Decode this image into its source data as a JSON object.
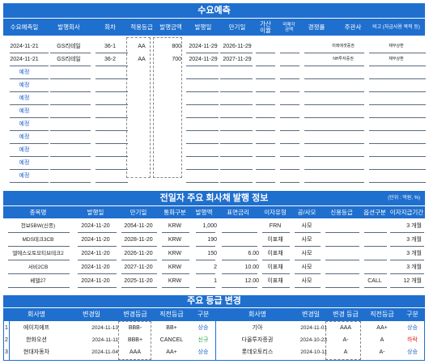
{
  "forecast": {
    "title": "수요예측",
    "headers": {
      "date": "수요예측일",
      "issuer": "발행회사",
      "round": "회차",
      "grade": "적용등급",
      "amount": "발행금액",
      "issue_date": "발행일",
      "maturity": "만기일",
      "extra_line1": "가산",
      "extra_line2": "이율",
      "unsold_line1": "미매각",
      "unsold_line2": "금액",
      "competition": "경쟁률",
      "manager": "주관사",
      "note": "비고 (자금사용 목적 등)"
    },
    "rows": [
      {
        "date": "2024-11-21",
        "issuer": "GS리테일",
        "round": "36-1",
        "grade": "AA",
        "amount": "800",
        "issue_date": "2024-11-29",
        "maturity": "2026-11-29",
        "manager": "미래에셋증권",
        "note": "채무상환"
      },
      {
        "date": "2024-11-21",
        "issuer": "GS리테일",
        "round": "36-2",
        "grade": "AA",
        "amount": "700",
        "issue_date": "2024-11-29",
        "maturity": "2027-11-29",
        "manager": "NH투자증권",
        "note": "채무상환"
      }
    ],
    "placeholder": "예정"
  },
  "issuance": {
    "title": "전일자 주요 회사채 발행 정보",
    "unit": "(단위 : 억원, %)",
    "headers": {
      "name": "종목명",
      "issue_date": "발행일",
      "maturity": "만기일",
      "currency": "통화구분",
      "amount": "발행액",
      "coupon": "표면금리",
      "rate_type": "이자유형",
      "offer": "공/사모",
      "credit": "신용등급",
      "option": "옵션구분",
      "period": "이자지급기간"
    },
    "rows": [
      {
        "name": "천보5BW(신종)",
        "issue_date": "2024-11-20",
        "maturity": "2054-11-20",
        "currency": "KRW",
        "amount": "1,000",
        "coupon": "",
        "rate_type": "FRN",
        "offer": "사모",
        "credit": "",
        "option": "",
        "period": "3 개월"
      },
      {
        "name": "MDS테크3CB",
        "issue_date": "2024-11-20",
        "maturity": "2028-11-20",
        "currency": "KRW",
        "amount": "190",
        "coupon": "",
        "rate_type": "이표채",
        "offer": "사모",
        "credit": "",
        "option": "",
        "period": "3 개월"
      },
      {
        "name": "엘에스오토모티브테크2",
        "issue_date": "2024-11-20",
        "maturity": "2026-11-20",
        "currency": "KRW",
        "amount": "150",
        "coupon": "6.00",
        "rate_type": "이표채",
        "offer": "사모",
        "credit": "",
        "option": "",
        "period": "3 개월"
      },
      {
        "name": "서비2CB",
        "issue_date": "2024-11-20",
        "maturity": "2027-11-20",
        "currency": "KRW",
        "amount": "2",
        "coupon": "10.00",
        "rate_type": "이표채",
        "offer": "사모",
        "credit": "",
        "option": "",
        "period": "3 개월"
      },
      {
        "name": "베델27",
        "issue_date": "2024-11-20",
        "maturity": "2025-11-20",
        "currency": "KRW",
        "amount": "1",
        "coupon": "12.00",
        "rate_type": "이표채",
        "offer": "사모",
        "credit": "",
        "option": "CALL",
        "period": "12 개월"
      }
    ]
  },
  "grades": {
    "title": "주요 등급 변경",
    "headers": {
      "company": "회사명",
      "date": "변경일",
      "new_grade": "변경등급",
      "old_grade": "직전등급",
      "type": "구분",
      "company2": "회사명",
      "date2": "변경일",
      "new_grade2": "변경 등급",
      "old_grade2": "직전등급",
      "type2": "구분"
    },
    "rows": [
      {
        "no": "1",
        "company": "에이치에프",
        "date": "2024-11-13",
        "new_grade": "BBB-",
        "old_grade": "BB+",
        "type": "상승",
        "company2": "기아",
        "date2": "2024-11-01",
        "new_grade2": "AAA",
        "old_grade2": "AA+",
        "type2": "상승"
      },
      {
        "no": "2",
        "company": "한화오션",
        "date": "2024-11-11",
        "new_grade": "BBB+",
        "old_grade": "CANCEL",
        "type": "신규",
        "company2": "다올투자증권",
        "date2": "2024-10-23",
        "new_grade2": "A-",
        "old_grade2": "A",
        "type2": "하락"
      },
      {
        "no": "3",
        "company": "현대자동차",
        "date": "2024-11-04",
        "new_grade": "AAA",
        "old_grade": "AA+",
        "type": "상승",
        "company2": "롯데오토리스",
        "date2": "2024-10-11",
        "new_grade2": "A",
        "old_grade2": "A-",
        "type2": "상승"
      }
    ],
    "colors": {
      "up": "#2060c8",
      "down": "#e02020",
      "new": "#2aa340"
    }
  }
}
